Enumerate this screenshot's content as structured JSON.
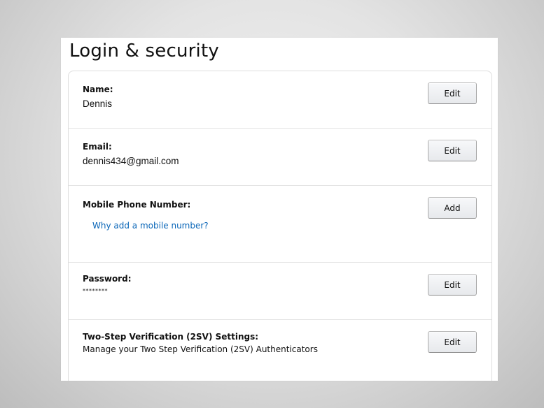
{
  "page": {
    "title": "Login & security"
  },
  "rows": [
    {
      "label": "Name:",
      "value": "Dennis",
      "button_label": "Edit"
    },
    {
      "label": "Email:",
      "value": "dennis434@gmail.com",
      "button_label": "Edit"
    },
    {
      "label": "Mobile Phone Number:",
      "link_text": "Why add a mobile number?",
      "button_label": "Add"
    },
    {
      "label": "Password:",
      "value": "********",
      "button_label": "Edit"
    },
    {
      "label": "Two-Step Verification (2SV) Settings:",
      "value": "Manage your Two Step Verification (2SV) Authenticators",
      "button_label": "Edit"
    }
  ],
  "colors": {
    "link": "#0a66b8",
    "text": "#111111",
    "background_center": "#f2f2f2",
    "background_edge": "#bdbdbd"
  }
}
